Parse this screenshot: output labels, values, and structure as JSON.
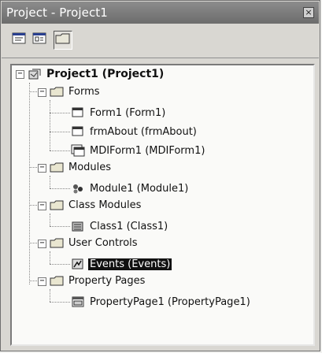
{
  "window": {
    "title": "Project - Project1",
    "close_glyph": "×"
  },
  "toolbar": {
    "buttons": [
      {
        "name": "view-code",
        "icon": "view-code-icon"
      },
      {
        "name": "view-object",
        "icon": "view-object-icon"
      },
      {
        "name": "toggle-folders",
        "icon": "folder-icon",
        "pressed": true
      }
    ]
  },
  "tree": {
    "root": "Project1 (Project1)",
    "folders": [
      {
        "label": "Forms",
        "items": [
          "Form1 (Form1)",
          "frmAbout (frmAbout)",
          "MDIForm1 (MDIForm1)"
        ]
      },
      {
        "label": "Modules",
        "items": [
          "Module1 (Module1)"
        ]
      },
      {
        "label": "Class Modules",
        "items": [
          "Class1 (Class1)"
        ]
      },
      {
        "label": "User Controls",
        "items": [
          "Events (Events)"
        ]
      },
      {
        "label": "Property Pages",
        "items": [
          "PropertyPage1 (PropertyPage1)"
        ]
      }
    ],
    "selected": "Events (Events)",
    "expander_glyph": "−"
  }
}
